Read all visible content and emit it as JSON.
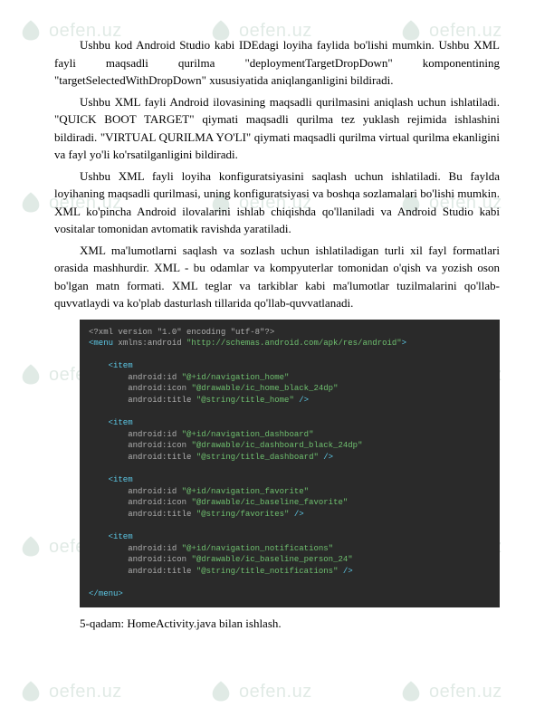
{
  "watermark": {
    "text": "oefen.uz"
  },
  "paragraphs": {
    "p1": "Ushbu kod Android Studio kabi IDEdagi loyiha faylida bo'lishi mumkin. Ushbu XML fayli maqsadli qurilma \"deploymentTargetDropDown\" komponentining \"targetSelectedWithDropDown\" xususiyatida aniqlanganligini bildiradi.",
    "p2": "Ushbu XML fayli Android ilovasining maqsadli qurilmasini aniqlash uchun ishlatiladi. \"QUICK BOOT TARGET\" qiymati maqsadli qurilma tez yuklash rejimida ishlashini bildiradi. \"VIRTUAL QURILMA YO'LI\" qiymati maqsadli qurilma virtual qurilma ekanligini va fayl yo'li ko'rsatilganligini bildiradi.",
    "p3": "Ushbu XML fayli loyiha konfiguratsiyasini saqlash uchun ishlatiladi. Bu faylda loyihaning maqsadli qurilmasi, uning konfiguratsiyasi va boshqa sozlamalari bo'lishi mumkin. XML ko'pincha Android ilovalarini ishlab chiqishda qo'llaniladi va Android Studio kabi vositalar tomonidan avtomatik ravishda yaratiladi.",
    "p4": "XML ma'lumotlarni saqlash va sozlash uchun ishlatiladigan turli xil fayl formatlari orasida mashhurdir. XML - bu odamlar va kompyuterlar tomonidan o'qish va yozish oson bo'lgan matn formati. XML teglar va tarkiblar kabi ma'lumotlar tuzilmalarini qo'llab-quvvatlaydi va ko'plab dasturlash tillarida qo'llab-quvvatlanadi."
  },
  "code": {
    "line1": "<?xml version \"1.0\" encoding \"utf-8\"?>",
    "line2_open": "<menu",
    "line2_attr": " xmlns:android ",
    "line2_val": "\"http://schemas.android.com/apk/res/android\"",
    "line2_close": ">",
    "item_open": "<item",
    "item_close": "/>",
    "menu_close": "</menu>",
    "items": [
      {
        "id": "\"@+id/navigation_home\"",
        "icon": "\"@drawable/ic_home_black_24dp\"",
        "title": "\"@string/title_home\""
      },
      {
        "id": "\"@+id/navigation_dashboard\"",
        "icon": "\"@drawable/ic_dashboard_black_24dp\"",
        "title": "\"@string/title_dashboard\""
      },
      {
        "id": "\"@+id/navigation_favorite\"",
        "icon": "\"@drawable/ic_baseline_favorite\"",
        "title": "\"@string/favorites\""
      },
      {
        "id": "\"@+id/navigation_notifications\"",
        "icon": "\"@drawable/ic_baseline_person_24\"",
        "title": "\"@string/title_notifications\""
      }
    ],
    "attr_id": "android:id ",
    "attr_icon": "android:icon ",
    "attr_title": "android:title "
  },
  "step": "5-qadam: HomeActivity.java bilan ishlash."
}
